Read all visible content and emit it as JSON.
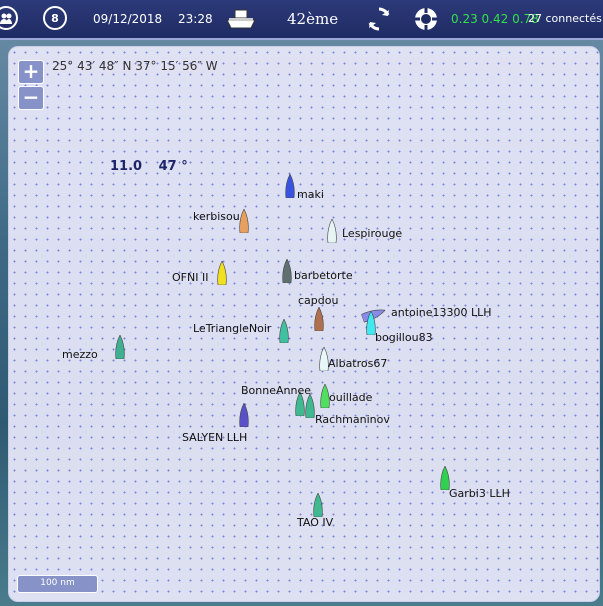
{
  "topbar": {
    "date": "09/12/2018",
    "time": "23:28",
    "rank": "42ème",
    "stats": "0.23 0.42 0.78",
    "connected": "27 connectés",
    "badge": "8"
  },
  "map": {
    "coordinates": "25° 43′ 48″ N 37° 15′ 56″ W",
    "wind_speed": "11.0",
    "wind_direction": "47 °",
    "zoom_in": "+",
    "zoom_out": "−",
    "scale_label": "100 nm"
  },
  "boats": [
    {
      "name": "maki",
      "color": "#3a52e0"
    },
    {
      "name": "kerbisou",
      "color": "#e8a060"
    },
    {
      "name": "Lespirouge",
      "color": "#e8f4f4"
    },
    {
      "name": "OFNI II",
      "color": "#f0e020"
    },
    {
      "name": "barbetorte",
      "color": "#607070"
    },
    {
      "name": "capdou",
      "color": "#b07050"
    },
    {
      "name": "antoine13300 LLH",
      "color": "#8a8ae8"
    },
    {
      "name": "bogillou83",
      "color": "#40e8f0"
    },
    {
      "name": "LeTriangleNoir",
      "color": "#40c0a0"
    },
    {
      "name": "mezzo",
      "color": "#40b090"
    },
    {
      "name": "Albatros67",
      "color": "#e8f8f8"
    },
    {
      "name": "BonneAnnee",
      "color": "#40b890"
    },
    {
      "name": "ouillade",
      "color": "#50e060"
    },
    {
      "name": "Rachmaninov",
      "color": "#40b890"
    },
    {
      "name": "SALYEN LLH",
      "color": "#5a50c8"
    },
    {
      "name": "Garbi3 LLH",
      "color": "#30d050"
    },
    {
      "name": "TAO IV",
      "color": "#40b890"
    }
  ]
}
